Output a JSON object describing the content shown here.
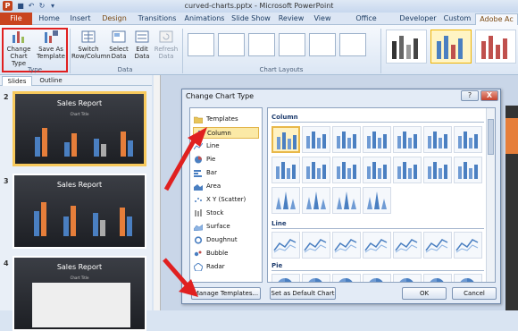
{
  "window": {
    "title": "curved-charts.pptx - Microsoft PowerPoint"
  },
  "tabs": {
    "file": "File",
    "items": [
      "Home",
      "Insert",
      "Design",
      "Transitions",
      "Animations",
      "Slide Show",
      "Review",
      "View",
      "Office Timeline+",
      "Developer",
      "Custom",
      "Adobe Ac"
    ]
  },
  "ribbon": {
    "type_group": {
      "change_chart_type": "Change Chart Type",
      "save_as_template": "Save As Template",
      "label": "Type"
    },
    "data_group": {
      "switch_row_column": "Switch Row/Column",
      "select_data": "Select Data",
      "edit_data": "Edit Data",
      "refresh_data": "Refresh Data",
      "label": "Data"
    },
    "layouts_group": {
      "label": "Chart Layouts"
    }
  },
  "slides_pane": {
    "tabs": [
      "Slides",
      "Outline"
    ],
    "slides": [
      {
        "number": "2",
        "title": "Sales Report",
        "chart_title": "Chart Title"
      },
      {
        "number": "3",
        "title": "Sales Report",
        "chart_title": ""
      },
      {
        "number": "4",
        "title": "Sales Report",
        "chart_title": "Chart Title"
      }
    ]
  },
  "dialog": {
    "title": "Change Chart Type",
    "help": "?",
    "close": "X",
    "categories": [
      "Templates",
      "Column",
      "Line",
      "Pie",
      "Bar",
      "Area",
      "X Y (Scatter)",
      "Stock",
      "Surface",
      "Doughnut",
      "Bubble",
      "Radar"
    ],
    "selected_category": "Column",
    "sections": {
      "column": "Column",
      "line": "Line",
      "pie": "Pie"
    },
    "buttons": {
      "manage_templates": "Manage Templates...",
      "set_default": "Set as Default Chart",
      "ok": "OK",
      "cancel": "Cancel"
    }
  },
  "colors": {
    "accent_red": "#e02020",
    "file_tab": "#c9441f",
    "selection": "#f7c95c"
  }
}
